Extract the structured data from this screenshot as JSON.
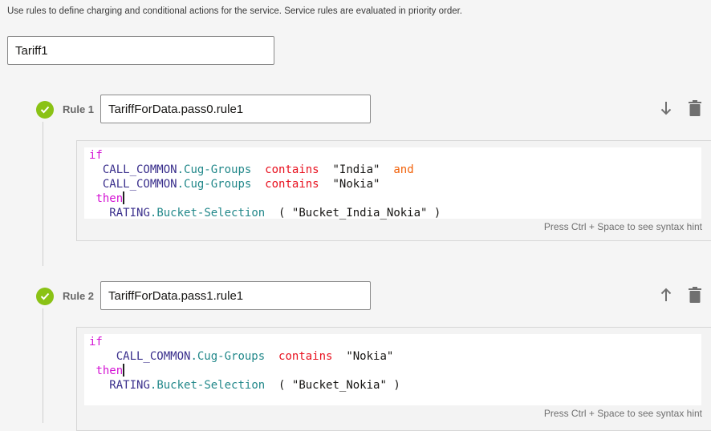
{
  "intro": "Use rules to define charging and conditional actions for the service. Service rules are evaluated in priority order.",
  "service_name": "Tariff1",
  "colors": {
    "check": "#8ac215",
    "keyword": "#d414d4",
    "object": "#3a2f8c",
    "attribute": "#22888a",
    "operator": "#e8101e",
    "and": "#f2620a"
  },
  "rules": [
    {
      "label": "Rule 1",
      "name": "TariffForData.pass0.rule1",
      "move_icon": "arrow-down-icon",
      "hint": "Press Ctrl + Space to see syntax hint",
      "code": [
        [
          {
            "t": "if",
            "c": "kw"
          }
        ],
        [
          {
            "t": "  "
          },
          {
            "t": "CALL_COMMON",
            "c": "obj"
          },
          {
            "t": ".",
            "c": "attr"
          },
          {
            "t": "Cug-Groups",
            "c": "attr"
          },
          {
            "t": "  "
          },
          {
            "t": "contains",
            "c": "op"
          },
          {
            "t": "  "
          },
          {
            "t": "\"India\"",
            "c": "str"
          },
          {
            "t": "  "
          },
          {
            "t": "and",
            "c": "and"
          }
        ],
        [
          {
            "t": "  "
          },
          {
            "t": "CALL_COMMON",
            "c": "obj"
          },
          {
            "t": ".",
            "c": "attr"
          },
          {
            "t": "Cug-Groups",
            "c": "attr"
          },
          {
            "t": "  "
          },
          {
            "t": "contains",
            "c": "op"
          },
          {
            "t": "  "
          },
          {
            "t": "\"Nokia\"",
            "c": "str"
          }
        ],
        [
          {
            "t": " "
          },
          {
            "t": "then",
            "c": "kw"
          },
          {
            "caret": true
          }
        ],
        [
          {
            "t": "   "
          },
          {
            "t": "RATING",
            "c": "obj"
          },
          {
            "t": ".",
            "c": "attr"
          },
          {
            "t": "Bucket-Selection",
            "c": "attr"
          },
          {
            "t": "  ( \"Bucket_India_Nokia\" )",
            "c": "str"
          }
        ]
      ]
    },
    {
      "label": "Rule 2",
      "name": "TariffForData.pass1.rule1",
      "move_icon": "arrow-up-icon",
      "hint": "Press Ctrl + Space to see syntax hint",
      "code": [
        [
          {
            "t": "if",
            "c": "kw"
          }
        ],
        [
          {
            "t": "    "
          },
          {
            "t": "CALL_COMMON",
            "c": "obj"
          },
          {
            "t": ".",
            "c": "attr"
          },
          {
            "t": "Cug-Groups",
            "c": "attr"
          },
          {
            "t": "  "
          },
          {
            "t": "contains",
            "c": "op"
          },
          {
            "t": "  "
          },
          {
            "t": "\"Nokia\"",
            "c": "str"
          }
        ],
        [
          {
            "t": " "
          },
          {
            "t": "then",
            "c": "kw"
          },
          {
            "caret": true
          }
        ],
        [
          {
            "t": "   "
          },
          {
            "t": "RATING",
            "c": "obj"
          },
          {
            "t": ".",
            "c": "attr"
          },
          {
            "t": "Bucket-Selection",
            "c": "attr"
          },
          {
            "t": "  ( \"Bucket_Nokia\" )",
            "c": "str"
          }
        ]
      ]
    }
  ]
}
